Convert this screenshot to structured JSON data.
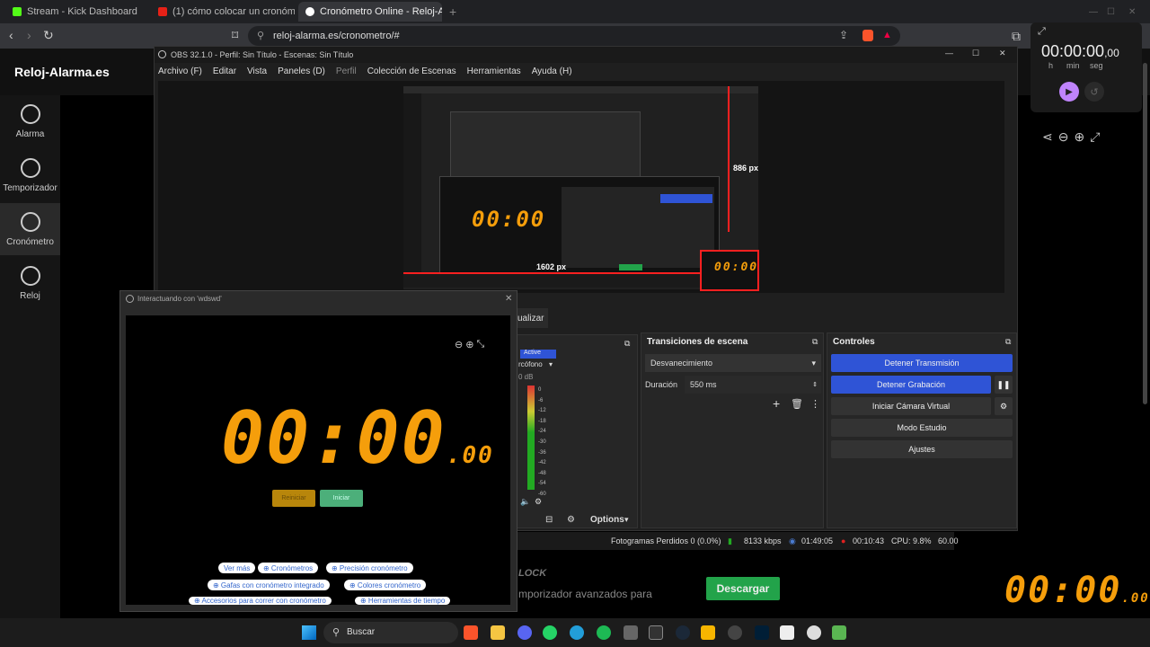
{
  "browser": {
    "tabs": [
      {
        "title": "Stream - Kick Dashboard"
      },
      {
        "title": "(1) cómo colocar un cronómetro en"
      },
      {
        "title": "Cronómetro Online - Reloj-Alarm"
      }
    ],
    "url": "reloj-alarma.es/cronometro/#"
  },
  "site": {
    "logo": "Reloj-Alarma.es",
    "sidebar": [
      {
        "label": "Alarma"
      },
      {
        "label": "Temporizador"
      },
      {
        "label": "Cronómetro"
      },
      {
        "label": "Reloj"
      }
    ],
    "download_label": "Descargar",
    "bg_text_1": "LOCK",
    "bg_text_2": "mporizador avanzados para",
    "corner_clock": {
      "main": "00:00",
      "frac": ".00"
    }
  },
  "widget": {
    "time_main": "00:00:00",
    "time_frac": ",00",
    "units": [
      "h",
      "min",
      "seg"
    ]
  },
  "obs": {
    "title": "OBS 32.1.0 - Perfil: Sin Título - Escenas: Sin Título",
    "menu": [
      "Archivo (F)",
      "Editar",
      "Vista",
      "Paneles (D)",
      "Perfil",
      "Colección de Escenas",
      "Herramientas",
      "Ayuda (H)"
    ],
    "preview_labels": {
      "height": "886 px",
      "width": "1602 px"
    },
    "update_label": "ualizar",
    "mixer": {
      "active": "Active",
      "source": "rcófono",
      "db": "0 dB",
      "scale": [
        "0",
        "-6",
        "-12",
        "-18",
        "-24",
        "-30",
        "-36",
        "-42",
        "-48",
        "-54",
        "-60"
      ],
      "options": "Options"
    },
    "transitions": {
      "title": "Transiciones de escena",
      "selected": "Desvanecimiento",
      "duration_label": "Duración",
      "duration_value": "550 ms"
    },
    "controls": {
      "title": "Controles",
      "buttons": [
        "Detener Transmisión",
        "Detener Grabación",
        "Iniciar Cámara Virtual",
        "Modo Estudio",
        "Ajustes"
      ]
    },
    "status": {
      "dropped": "Fotogramas Perdidos 0 (0.0%)",
      "bitrate": "8133 kbps",
      "stream_time": "01:49:05",
      "rec_time": "00:10:43",
      "cpu": "CPU: 9.8%",
      "fps": "60.00"
    }
  },
  "interact": {
    "title": "Interactuando con 'wdswd'",
    "time_main": "00:00",
    "time_frac": ".00",
    "reset_label": "Reiniciar",
    "start_label": "Iniciar",
    "chips": [
      "Ver más",
      "⊕ Cronómetros",
      "⊕ Precisión cronómetro",
      "⊕ Gafas con cronómetro integrado",
      "⊕ Colores cronómetro",
      "⊕ Accesorios para correr con cronómetro",
      "⊕ Herramientas de tiempo"
    ]
  },
  "taskbar": {
    "search": "Buscar"
  },
  "colors": {
    "accent_blue": "#2f54d6",
    "digit": "#f59e0b",
    "green": "#22a34a",
    "widget_play": "#c084fc"
  }
}
